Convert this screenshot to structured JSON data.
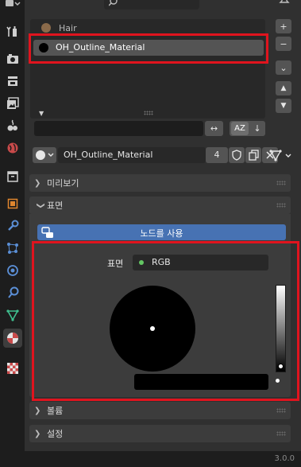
{
  "material_slots": [
    {
      "name": "Hair",
      "selected": false
    },
    {
      "name": "OH_Outline_Material",
      "selected": true
    }
  ],
  "list_controls": {
    "add": "+",
    "remove": "−",
    "specials": "⌄",
    "move_up": "▲",
    "move_down": "▼",
    "filter_placeholder": "",
    "sort_alpha": "AZ",
    "sort_reverse": "↓"
  },
  "material_selector": {
    "name": "OH_Outline_Material",
    "users": "4"
  },
  "panels": {
    "preview": "미리보기",
    "surface": "표면",
    "volume": "볼륨",
    "settings": "설정"
  },
  "use_nodes_label": "노드를 사용",
  "surface_row": {
    "label": "표면",
    "value": "RGB"
  },
  "color_wheel": {
    "current_color": "#000000",
    "value_level": 0.0
  },
  "version": "3.0.0",
  "colors": {
    "highlight": "#e0141e",
    "accent_blue": "#4772b3",
    "socket_green": "#63c763"
  }
}
